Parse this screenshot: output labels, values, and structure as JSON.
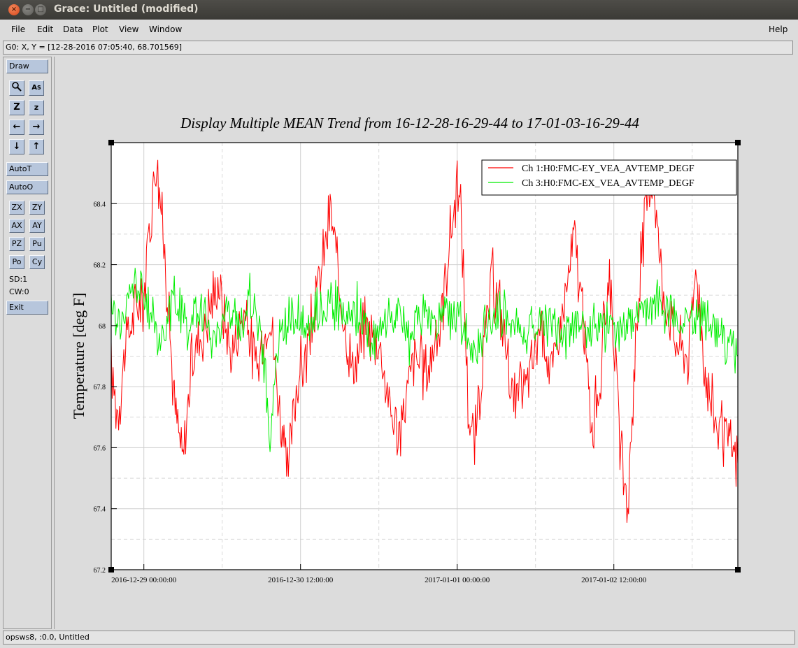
{
  "window": {
    "title": "Grace: Untitled (modified)",
    "close_glyph": "×",
    "min_glyph": "−",
    "max_glyph": "□"
  },
  "menu": {
    "file": "File",
    "edit": "Edit",
    "data": "Data",
    "plot": "Plot",
    "view": "View",
    "window": "Window",
    "help": "Help"
  },
  "coord_readout": "G0: X, Y = [12-28-2016 07:05:40, 68.701569]",
  "tools": {
    "draw": "Draw",
    "autot": "AutoT",
    "autoo": "AutoO",
    "zx": "ZX",
    "zy": "ZY",
    "ax": "AX",
    "ay": "AY",
    "pz": "PZ",
    "pu": "Pu",
    "po": "Po",
    "cy": "Cy",
    "sd": "SD:1",
    "cw": "CW:0",
    "exit": "Exit",
    "icons": [
      "zoom-icon",
      "autoscale-icon",
      "zoom-in-icon",
      "zoom-out-icon",
      "left-arrow-icon",
      "right-arrow-icon",
      "down-arrow-icon",
      "up-arrow-icon"
    ]
  },
  "status": "opsws8, :0.0, Untitled",
  "chart_data": {
    "type": "line",
    "title": "Display Multiple MEAN Trend from 16-12-28-16-29-44 to 17-01-03-16-29-44",
    "xlabel": "",
    "ylabel": "Temperature [deg F]",
    "ylim": [
      67.2,
      68.6
    ],
    "yticks": [
      "67.2",
      "67.4",
      "67.6",
      "67.8",
      "68",
      "68.2",
      "68.4"
    ],
    "xticks": [
      "2016-12-29 00:00:00",
      "2016-12-30 12:00:00",
      "2017-01-01 00:00:00",
      "2017-01-02 12:00:00"
    ],
    "grid": true,
    "legend_position": "top-right",
    "series": [
      {
        "name": "Ch 1:H0:FMC-EY_VEA_AVTEMP_DEGF",
        "color": "#ff0000",
        "points": [
          [
            "2016-12-28 16:30",
            67.85
          ],
          [
            "2016-12-28 18:00",
            67.72
          ],
          [
            "2016-12-28 20:00",
            67.95
          ],
          [
            "2016-12-28 22:00",
            68.05
          ],
          [
            "2016-12-29 00:00",
            68.1
          ],
          [
            "2016-12-29 02:00",
            68.45
          ],
          [
            "2016-12-29 03:00",
            68.55
          ],
          [
            "2016-12-29 05:00",
            68.2
          ],
          [
            "2016-12-29 07:00",
            67.75
          ],
          [
            "2016-12-29 09:00",
            67.55
          ],
          [
            "2016-12-29 11:00",
            67.9
          ],
          [
            "2016-12-29 14:00",
            68.0
          ],
          [
            "2016-12-29 17:00",
            68.15
          ],
          [
            "2016-12-29 20:00",
            67.9
          ],
          [
            "2016-12-29 23:00",
            68.05
          ],
          [
            "2016-12-30 02:00",
            67.85
          ],
          [
            "2016-12-30 05:00",
            68.05
          ],
          [
            "2016-12-30 07:00",
            67.75
          ],
          [
            "2016-12-30 09:00",
            67.5
          ],
          [
            "2016-12-30 11:00",
            67.8
          ],
          [
            "2016-12-30 14:00",
            67.95
          ],
          [
            "2016-12-30 17:00",
            68.2
          ],
          [
            "2016-12-30 19:00",
            68.38
          ],
          [
            "2016-12-30 21:00",
            68.1
          ],
          [
            "2016-12-31 00:00",
            67.85
          ],
          [
            "2016-12-31 03:00",
            68.0
          ],
          [
            "2016-12-31 06:00",
            67.95
          ],
          [
            "2016-12-31 09:00",
            67.7
          ],
          [
            "2016-12-31 11:00",
            67.65
          ],
          [
            "2016-12-31 14:00",
            67.9
          ],
          [
            "2016-12-31 17:00",
            67.85
          ],
          [
            "2016-12-31 20:00",
            68.0
          ],
          [
            "2016-12-31 22:00",
            68.25
          ],
          [
            "2017-01-01 00:00",
            68.45
          ],
          [
            "2017-01-01 01:00",
            68.35
          ],
          [
            "2017-01-01 02:30",
            67.75
          ],
          [
            "2017-01-01 04:00",
            67.6
          ],
          [
            "2017-01-01 06:00",
            67.9
          ],
          [
            "2017-01-01 08:00",
            68.15
          ],
          [
            "2017-01-01 10:00",
            68.05
          ],
          [
            "2017-01-01 13:00",
            67.75
          ],
          [
            "2017-01-01 16:00",
            67.8
          ],
          [
            "2017-01-01 19:00",
            68.0
          ],
          [
            "2017-01-01 22:00",
            67.85
          ],
          [
            "2017-01-02 01:00",
            68.1
          ],
          [
            "2017-01-02 03:00",
            68.3
          ],
          [
            "2017-01-02 05:00",
            68.0
          ],
          [
            "2017-01-02 07:00",
            67.65
          ],
          [
            "2017-01-02 09:00",
            67.85
          ],
          [
            "2017-01-02 11:00",
            68.2
          ],
          [
            "2017-01-02 13:00",
            67.7
          ],
          [
            "2017-01-02 15:00",
            67.35
          ],
          [
            "2017-01-02 17:00",
            67.95
          ],
          [
            "2017-01-02 19:00",
            68.35
          ],
          [
            "2017-01-02 21:00",
            68.5
          ],
          [
            "2017-01-02 23:00",
            68.15
          ],
          [
            "2017-01-03 02:00",
            67.95
          ],
          [
            "2017-01-03 05:00",
            67.9
          ],
          [
            "2017-01-03 07:00",
            68.2
          ],
          [
            "2017-01-03 09:00",
            67.85
          ],
          [
            "2017-01-03 11:00",
            67.7
          ],
          [
            "2017-01-03 13:00",
            67.65
          ],
          [
            "2017-01-03 16:29",
            67.55
          ]
        ]
      },
      {
        "name": "Ch 3:H0:FMC-EX_VEA_AVTEMP_DEGF",
        "color": "#00ee00",
        "points": [
          [
            "2016-12-28 16:30",
            68.05
          ],
          [
            "2016-12-28 19:00",
            68.0
          ],
          [
            "2016-12-28 22:00",
            68.15
          ],
          [
            "2016-12-29 01:00",
            68.05
          ],
          [
            "2016-12-29 04:00",
            67.95
          ],
          [
            "2016-12-29 07:00",
            68.1
          ],
          [
            "2016-12-29 10:00",
            68.0
          ],
          [
            "2016-12-29 13:00",
            68.05
          ],
          [
            "2016-12-29 16:00",
            67.95
          ],
          [
            "2016-12-29 19:00",
            68.05
          ],
          [
            "2016-12-29 22:00",
            68.0
          ],
          [
            "2016-12-30 01:00",
            68.1
          ],
          [
            "2016-12-30 03:00",
            67.95
          ],
          [
            "2016-12-30 05:00",
            67.65
          ],
          [
            "2016-12-30 07:00",
            67.95
          ],
          [
            "2016-12-30 10:00",
            68.05
          ],
          [
            "2016-12-30 13:00",
            68.0
          ],
          [
            "2016-12-30 16:00",
            68.05
          ],
          [
            "2016-12-30 19:00",
            68.1
          ],
          [
            "2016-12-30 22:00",
            68.0
          ],
          [
            "2016-12-31 01:00",
            68.05
          ],
          [
            "2016-12-31 04:00",
            67.95
          ],
          [
            "2016-12-31 07:00",
            68.0
          ],
          [
            "2016-12-31 10:00",
            68.05
          ],
          [
            "2016-12-31 13:00",
            67.95
          ],
          [
            "2016-12-31 16:00",
            68.05
          ],
          [
            "2016-12-31 19:00",
            68.0
          ],
          [
            "2016-12-31 22:00",
            68.05
          ],
          [
            "2017-01-01 01:00",
            68.0
          ],
          [
            "2017-01-01 04:00",
            67.9
          ],
          [
            "2017-01-01 07:00",
            68.0
          ],
          [
            "2017-01-01 10:00",
            68.05
          ],
          [
            "2017-01-01 13:00",
            68.0
          ],
          [
            "2017-01-01 16:00",
            67.98
          ],
          [
            "2017-01-01 19:00",
            68.02
          ],
          [
            "2017-01-01 22:00",
            68.0
          ],
          [
            "2017-01-02 01:00",
            67.98
          ],
          [
            "2017-01-02 04:00",
            68.02
          ],
          [
            "2017-01-02 07:00",
            68.0
          ],
          [
            "2017-01-02 10:00",
            68.0
          ],
          [
            "2017-01-02 13:00",
            67.97
          ],
          [
            "2017-01-02 16:00",
            68.0
          ],
          [
            "2017-01-02 19:00",
            68.05
          ],
          [
            "2017-01-02 22:00",
            68.08
          ],
          [
            "2017-01-03 01:00",
            68.05
          ],
          [
            "2017-01-03 04:00",
            68.0
          ],
          [
            "2017-01-03 07:00",
            68.05
          ],
          [
            "2017-01-03 10:00",
            68.02
          ],
          [
            "2017-01-03 13:00",
            67.95
          ],
          [
            "2017-01-03 16:29",
            67.9
          ]
        ]
      }
    ]
  }
}
